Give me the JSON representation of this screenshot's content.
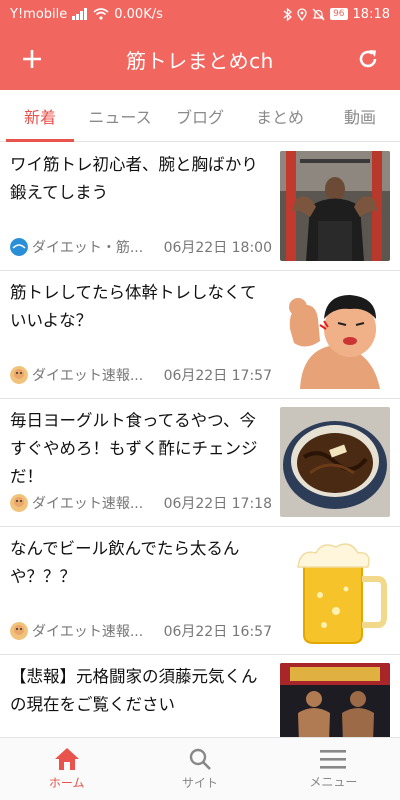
{
  "status_bar": {
    "carrier": "Y!mobile",
    "speed": "0.00K/s",
    "battery": "96",
    "time": "18:18"
  },
  "app_bar": {
    "title": "筋トレまとめch",
    "add_icon": "plus-icon",
    "refresh_icon": "refresh-icon"
  },
  "tabs": [
    {
      "label": "新着",
      "active": true
    },
    {
      "label": "ニュース",
      "active": false
    },
    {
      "label": "ブログ",
      "active": false
    },
    {
      "label": "まとめ",
      "active": false
    },
    {
      "label": "動画",
      "active": false
    }
  ],
  "articles": [
    {
      "title": "ワイ筋トレ初心者、腕と胸ばかり鍛えてしまう",
      "site": "ダイエット・筋...",
      "date": "06月22日 18:00",
      "thumb": "gym-man-photo"
    },
    {
      "title": "筋トレしてたら体幹トレしなくていいよな？",
      "site": "ダイエット速報...",
      "date": "06月22日 17:57",
      "thumb": "muscle-cartoon"
    },
    {
      "title": "毎日ヨーグルト食ってるやつ、今すぐやめろ！もずく酢にチェンジだ！",
      "site": "ダイエット速報...",
      "date": "06月22日 17:18",
      "thumb": "mozuku-bowl-photo"
    },
    {
      "title": "なんでビール飲んでたら太るんや？？？",
      "site": "ダイエット速報...",
      "date": "06月22日 16:57",
      "thumb": "beer-mug-illustration"
    },
    {
      "title": "【悲報】元格闘家の須藤元気くんの現在をご覧ください",
      "site": "",
      "date": "",
      "thumb": "bodybuilders-photo"
    }
  ],
  "bottom_nav": [
    {
      "label": "ホーム",
      "icon": "home-icon",
      "active": true
    },
    {
      "label": "サイト",
      "icon": "search-icon",
      "active": false
    },
    {
      "label": "メニュー",
      "icon": "menu-icon",
      "active": false
    }
  ],
  "colors": {
    "primary": "#f1665f",
    "accent": "#e8534c"
  }
}
